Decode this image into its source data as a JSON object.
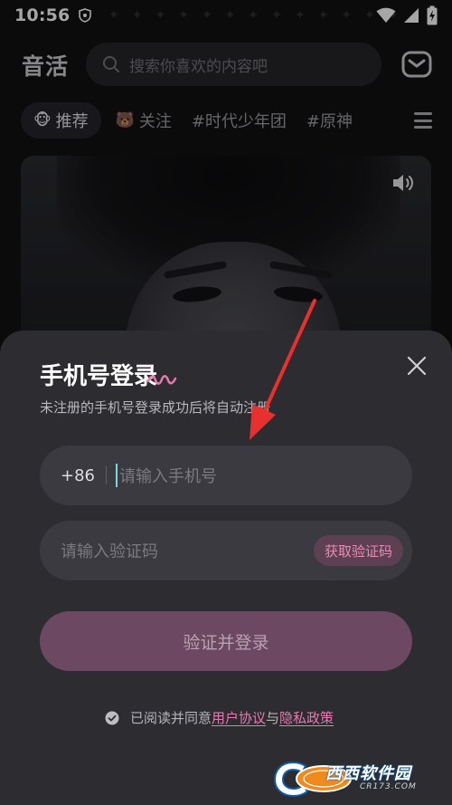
{
  "status_bar": {
    "time": "10:56",
    "icons": [
      "shield-icon",
      "wifi-icon",
      "signal-icon",
      "battery-charging-icon"
    ]
  },
  "header": {
    "logo": "音活",
    "search_placeholder": "搜索你喜欢的内容吧",
    "search_icon": "search-icon",
    "mail_icon": "mail-icon"
  },
  "tabs": [
    {
      "label": "推荐",
      "icon": "avatar-emoji",
      "active": true
    },
    {
      "label": "关注",
      "icon": "avatar-emoji",
      "active": false
    },
    {
      "label": "#时代少年团",
      "active": false
    },
    {
      "label": "#原神",
      "active": false
    }
  ],
  "menu_icon": "hamburger-menu-icon",
  "hero": {
    "volume_icon": "volume-icon"
  },
  "login_sheet": {
    "title": "手机号登录",
    "subtitle": "未注册的手机号登录成功后将自动注册",
    "close_icon": "close-icon",
    "phone_prefix": "+86",
    "phone_placeholder": "请输入手机号",
    "code_placeholder": "请输入验证码",
    "get_code_label": "获取验证码",
    "submit_label": "验证并登录",
    "agreement": {
      "prefix": "已阅读并同意",
      "user_agreement": "用户协议",
      "connector": "与",
      "privacy_policy": "隐私政策"
    }
  },
  "watermark": {
    "text": "西西软件园",
    "sub": "CR173.COM"
  },
  "colors": {
    "accent_pink": "#e67ab0",
    "sheet_bg": "#2c2c31",
    "field_bg": "#3a3a40",
    "button_bg": "#6c4862"
  }
}
